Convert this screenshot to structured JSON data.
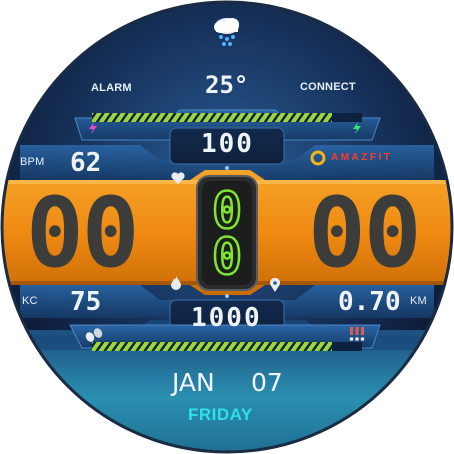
{
  "weather": {
    "icon": "snow-cloud-icon",
    "temperature": "25°"
  },
  "alarm_label": "ALARM",
  "connect_label": "CONNECT",
  "battery_bar": {
    "icon": "charging-bolt-icon",
    "level": 0.85
  },
  "steps_bar": {
    "icon": "footsteps-icon",
    "level": 0.85
  },
  "heart_rate": {
    "label": "BPM",
    "value": "62",
    "icon": "heart-icon"
  },
  "battery_value": "100",
  "brand": {
    "text": "AMAZFIT",
    "color": "#ff3b2a"
  },
  "time": {
    "hours": "00",
    "minutes": "00",
    "colon_top": "0",
    "colon_bottom": "0"
  },
  "calories": {
    "label": "KC",
    "value": "75",
    "icon": "flame-icon"
  },
  "distance": {
    "label": "KM",
    "value": "0.70",
    "icon": "location-pin-icon"
  },
  "steps_value": "1000",
  "notification_icon": "notification-icon",
  "date": {
    "month": "JAN",
    "day": "07",
    "weekday": "FRIDAY"
  },
  "colors": {
    "accent_orange": "#f08a12",
    "digit_green": "#7ee534",
    "weekday_cyan": "#2fe0ea",
    "panel_blue": "#1f4f86"
  }
}
